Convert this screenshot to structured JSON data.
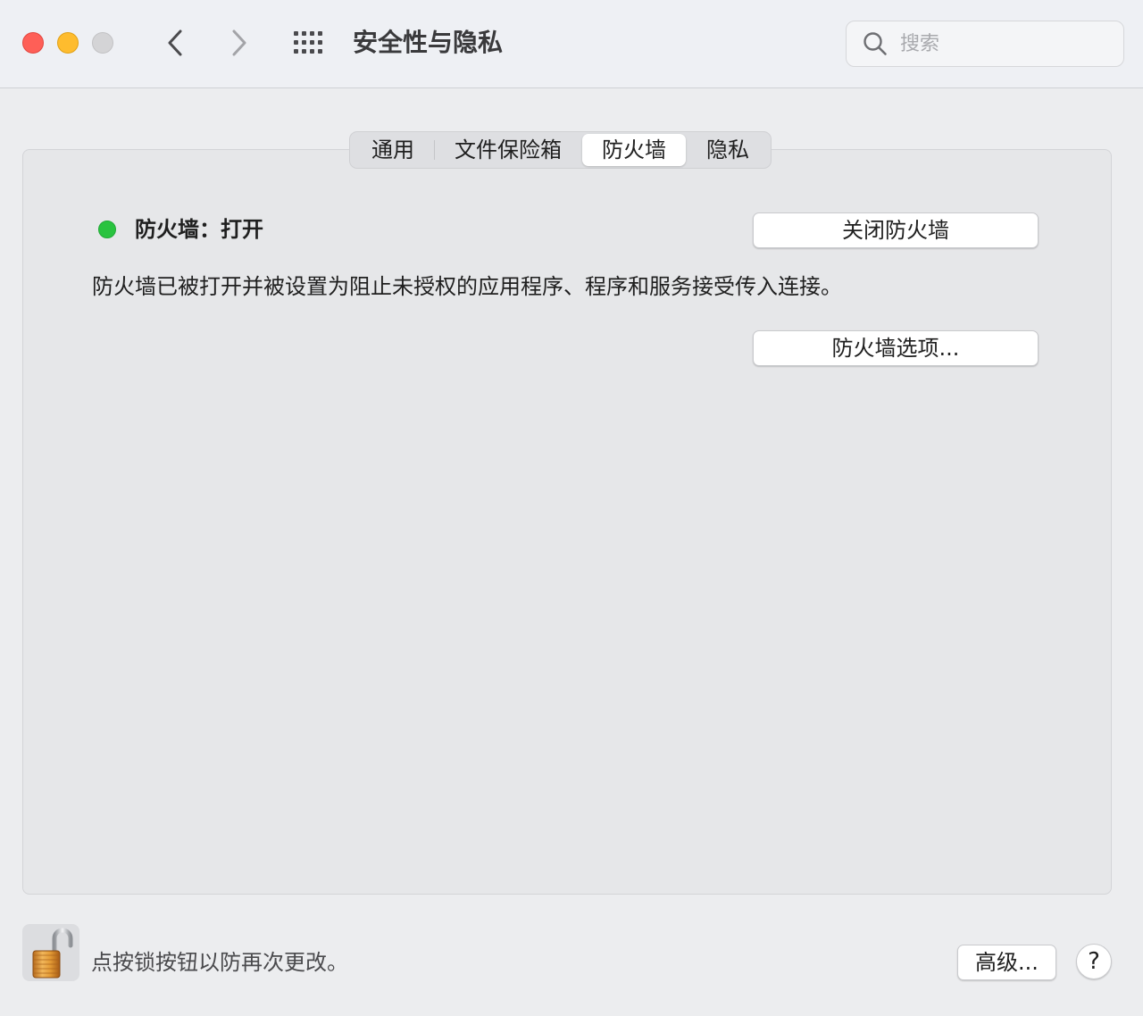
{
  "window": {
    "title": "安全性与隐私",
    "traffic_lights": {
      "close_color": "#fe5f57",
      "minimize_color": "#febc2e",
      "zoom_color": "#d4d4d6"
    }
  },
  "toolbar": {
    "back_icon": "chevron-left-icon",
    "forward_icon": "chevron-right-icon",
    "grid_icon": "grid-icon"
  },
  "search": {
    "placeholder": "搜索",
    "value": ""
  },
  "tabs": [
    {
      "label": "通用",
      "active": false
    },
    {
      "label": "文件保险箱",
      "active": false
    },
    {
      "label": "防火墙",
      "active": true
    },
    {
      "label": "隐私",
      "active": false
    }
  ],
  "firewall": {
    "status_label": "防火墙：打开",
    "status_color": "#29c33f",
    "turn_off_button": "关闭防火墙",
    "description": "防火墙已被打开并被设置为阻止未授权的应用程序、程序和服务接受传入连接。",
    "options_button": "防火墙选项..."
  },
  "footer": {
    "lock_icon": "padlock-open-icon",
    "lock_hint": "点按锁按钮以防再次更改。",
    "advanced_button": "高级...",
    "help_button": "?"
  }
}
